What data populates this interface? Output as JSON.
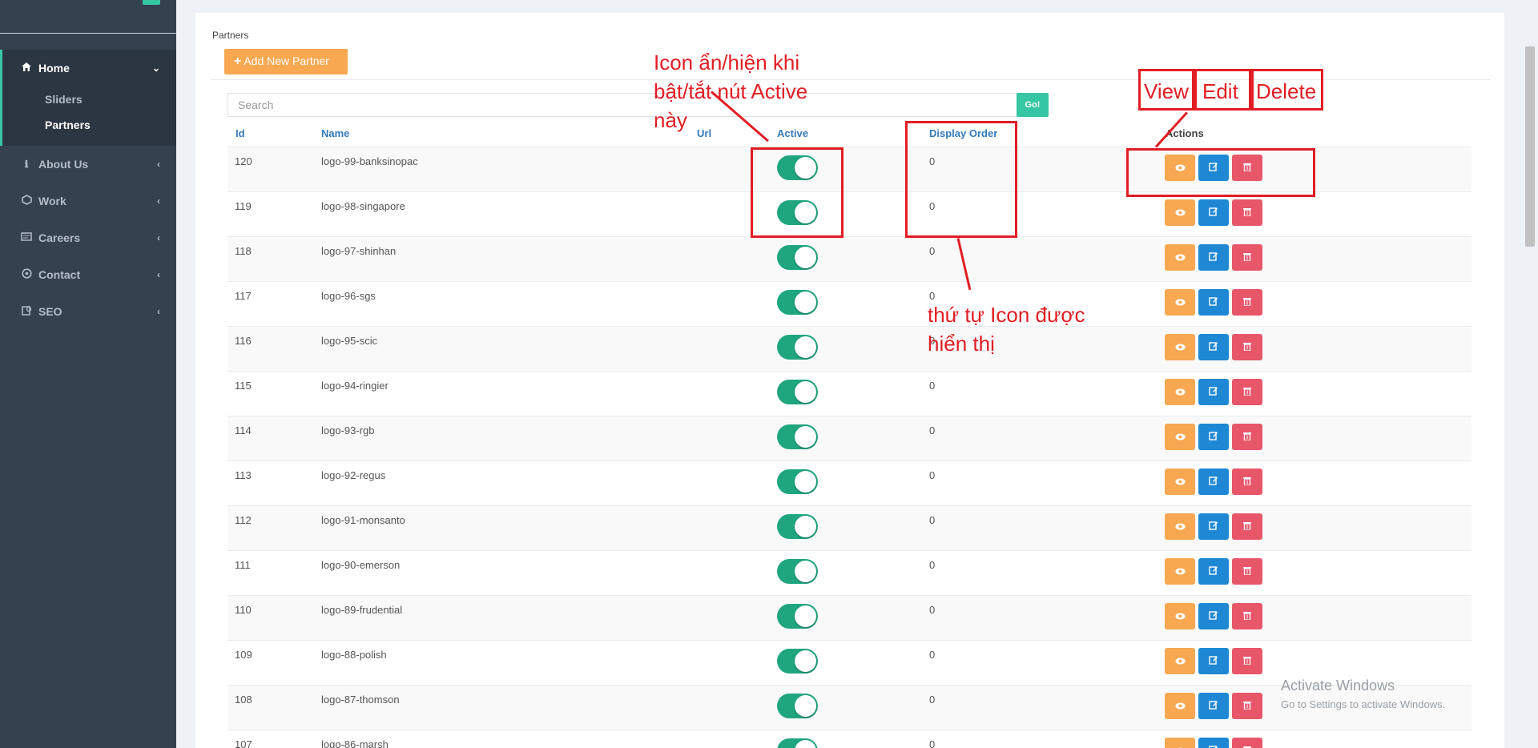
{
  "sidebar": {
    "items": [
      {
        "label": "Home",
        "icon": "home-icon",
        "chevron": "⌄",
        "active": true
      },
      {
        "label": "About Us",
        "icon": "info-icon",
        "chevron": "‹"
      },
      {
        "label": "Work",
        "icon": "work-icon",
        "chevron": "‹"
      },
      {
        "label": "Careers",
        "icon": "careers-icon",
        "chevron": "‹"
      },
      {
        "label": "Contact",
        "icon": "contact-icon",
        "chevron": "‹"
      },
      {
        "label": "SEO",
        "icon": "seo-icon",
        "chevron": "‹"
      }
    ],
    "sub_items": [
      {
        "label": "Sliders"
      },
      {
        "label": "Partners",
        "active": true
      }
    ]
  },
  "page": {
    "breadcrumb": "Partners",
    "add_button": "Add New Partner",
    "search_placeholder": "Search",
    "go_button": "Go!"
  },
  "table": {
    "headers": {
      "id": "Id",
      "name": "Name",
      "url": "Url",
      "active": "Active",
      "display_order": "Display Order",
      "actions": "Actions"
    },
    "rows": [
      {
        "id": "120",
        "name": "logo-99-banksinopac",
        "active": true,
        "order": "0"
      },
      {
        "id": "119",
        "name": "logo-98-singapore",
        "active": true,
        "order": "0"
      },
      {
        "id": "118",
        "name": "logo-97-shinhan",
        "active": true,
        "order": "0"
      },
      {
        "id": "117",
        "name": "logo-96-sgs",
        "active": true,
        "order": "0"
      },
      {
        "id": "116",
        "name": "logo-95-scic",
        "active": true,
        "order": "0"
      },
      {
        "id": "115",
        "name": "logo-94-ringier",
        "active": true,
        "order": "0"
      },
      {
        "id": "114",
        "name": "logo-93-rgb",
        "active": true,
        "order": "0"
      },
      {
        "id": "113",
        "name": "logo-92-regus",
        "active": true,
        "order": "0"
      },
      {
        "id": "112",
        "name": "logo-91-monsanto",
        "active": true,
        "order": "0"
      },
      {
        "id": "111",
        "name": "logo-90-emerson",
        "active": true,
        "order": "0"
      },
      {
        "id": "110",
        "name": "logo-89-frudential",
        "active": true,
        "order": "0"
      },
      {
        "id": "109",
        "name": "logo-88-polish",
        "active": true,
        "order": "0"
      },
      {
        "id": "108",
        "name": "logo-87-thomson",
        "active": true,
        "order": "0"
      },
      {
        "id": "107",
        "name": "logo-86-marsh",
        "active": true,
        "order": "0"
      }
    ]
  },
  "annotations": {
    "active_note": [
      "Icon ẩn/hiện khi",
      "bật/tắt nút Active",
      "này"
    ],
    "order_note": [
      "thứ tự Icon được",
      "hiển thị"
    ],
    "view": "View",
    "edit": "Edit",
    "delete": "Delete"
  },
  "watermark": {
    "title": "Activate Windows",
    "subtitle": "Go to Settings to activate Windows."
  },
  "colors": {
    "sidebar_bg": "#364150",
    "accent": "#36c6a3",
    "toggle_on": "#1fa67f",
    "view_btn": "#f7a851",
    "edit_btn": "#1e88d4",
    "delete_btn": "#e8566a",
    "annotation": "#e21d24"
  }
}
